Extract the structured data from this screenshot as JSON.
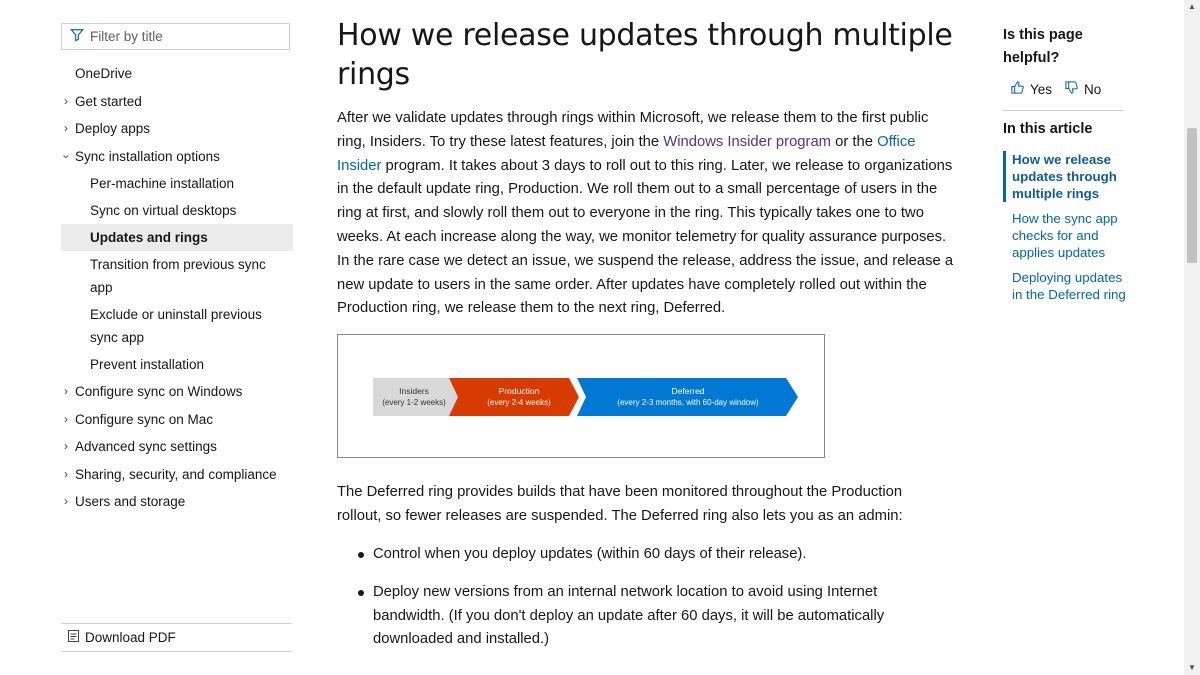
{
  "filter": {
    "placeholder": "Filter by title",
    "icon": "filter-icon"
  },
  "nav": {
    "items": [
      {
        "label": "OneDrive",
        "type": "top",
        "chevron": "none"
      },
      {
        "label": "Get started",
        "type": "top",
        "chevron": "right"
      },
      {
        "label": "Deploy apps",
        "type": "top",
        "chevron": "right"
      },
      {
        "label": "Sync installation options",
        "type": "top",
        "chevron": "down"
      },
      {
        "label": "Per-machine installation",
        "type": "sub"
      },
      {
        "label": "Sync on virtual desktops",
        "type": "sub"
      },
      {
        "label": "Updates and rings",
        "type": "sub",
        "active": true
      },
      {
        "label": "Transition from previous sync app",
        "type": "sub"
      },
      {
        "label": "Exclude or uninstall previous sync app",
        "type": "sub"
      },
      {
        "label": "Prevent installation",
        "type": "sub"
      },
      {
        "label": "Configure sync on Windows",
        "type": "top",
        "chevron": "right"
      },
      {
        "label": "Configure sync on Mac",
        "type": "top",
        "chevron": "right"
      },
      {
        "label": "Advanced sync settings",
        "type": "top",
        "chevron": "right"
      },
      {
        "label": "Sharing, security, and compliance",
        "type": "top",
        "chevron": "right"
      },
      {
        "label": "Users and storage",
        "type": "top",
        "chevron": "right"
      }
    ],
    "download_pdf": "Download PDF"
  },
  "article": {
    "title": "How we release updates through multiple rings",
    "p1": {
      "t1": "After we validate updates through rings within Microsoft, we release them to the first public ring, Insiders. To try these latest features, join the ",
      "link1": "Windows Insider program",
      "t2": " or the ",
      "link2": "Office Insider",
      "t3": " program. It takes about 3 days to roll out to this ring. Later, we release to organizations in the default update ring, Production. We roll them out to a small percentage of users in the ring at first, and slowly roll them out to everyone in the ring. This typically takes one to two weeks. At each increase along the way, we monitor telemetry for quality assurance purposes. In the rare case we detect an issue, we suspend the release, address the issue, and release a new update to users in the same order. After updates have completely rolled out within the Production ring, we release them to the next ring, Deferred."
    },
    "diagram": {
      "rings": [
        {
          "name": "Insiders",
          "detail": "(every 1-2 weeks)",
          "color": "#d9d9d9",
          "text_color": "#333333"
        },
        {
          "name": "Production",
          "detail": "(every 2-4 weeks)",
          "color": "#d83b01",
          "text_color": "#ffffff"
        },
        {
          "name": "Deferred",
          "detail": "(every 2-3 months, with 60-day window)",
          "color": "#0078d4",
          "text_color": "#ffffff"
        }
      ]
    },
    "p2": "The Deferred ring provides builds that have been monitored throughout the Production rollout, so fewer releases are suspended. The Deferred ring also lets you as an admin:",
    "bullets": [
      "Control when you deploy updates (within 60 days of their release).",
      "Deploy new versions from an internal network location to avoid using Internet bandwidth. (If you don't deploy an update after 60 days, it will be automatically downloaded and installed.)"
    ]
  },
  "rail": {
    "helpful_question": "Is this page helpful?",
    "yes": "Yes",
    "no": "No",
    "in_this_article": "In this article",
    "toc": [
      {
        "label": "How we release updates through multiple rings",
        "current": true
      },
      {
        "label": "How the sync app checks for and applies updates",
        "current": false
      },
      {
        "label": "Deploying updates in the Deferred ring",
        "current": false
      }
    ]
  },
  "colors": {
    "link": "#0065b3",
    "visited_link": "#5c2e91",
    "active_nav_bg": "#ebebeb"
  }
}
